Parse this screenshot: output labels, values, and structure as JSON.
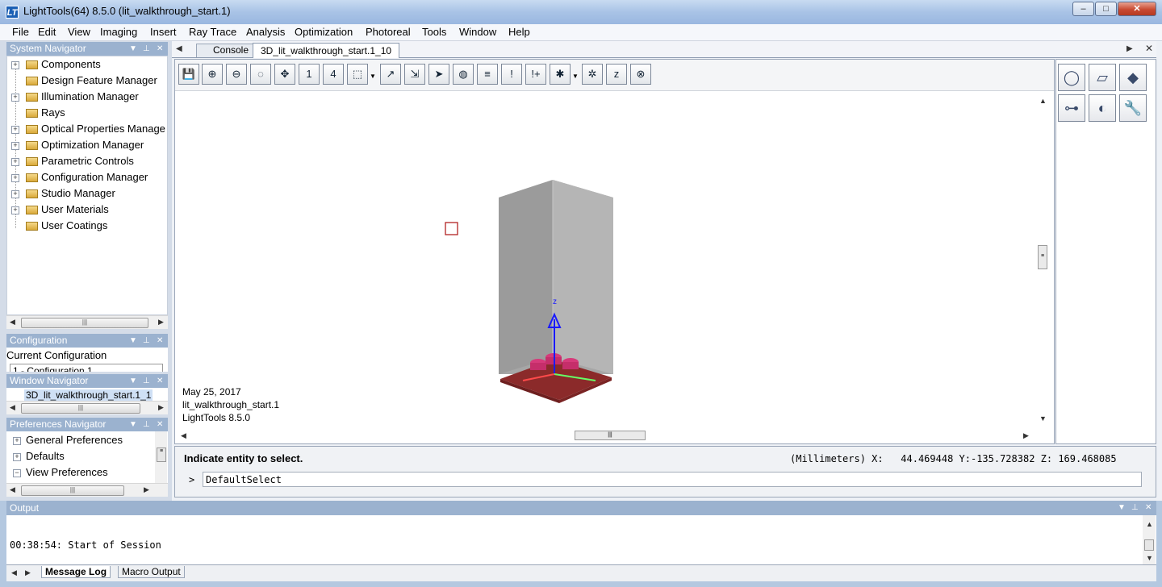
{
  "window": {
    "title": "LightTools(64) 8.5.0  (lit_walkthrough_start.1)",
    "app_icon": "LT",
    "minimize": "–",
    "maximize": "□",
    "close": "✕"
  },
  "menu": [
    "File",
    "Edit",
    "View",
    "Imaging",
    "Insert",
    "Ray Trace",
    "Analysis",
    "Optimization",
    "Photoreal",
    "Tools",
    "Window",
    "Help"
  ],
  "system_navigator": {
    "title": "System Navigator",
    "items": [
      "Components",
      "Design Feature Manager",
      "Illumination Manager",
      "Rays",
      "Optical Properties Manage",
      "Optimization Manager",
      "Parametric Controls",
      "Configuration Manager",
      "Studio Manager",
      "User Materials",
      "User Coatings"
    ]
  },
  "configuration_panel": {
    "title": "Configuration",
    "label": "Current Configuration",
    "value": "1 - Configuration 1"
  },
  "window_navigator": {
    "title": "Window Navigator",
    "item": "3D_lit_walkthrough_start.1_1"
  },
  "preferences_navigator": {
    "title": "Preferences Navigator",
    "items": [
      "General Preferences",
      "Defaults",
      "View Preferences"
    ]
  },
  "tabs": [
    "Console",
    "3D_lit_walkthrough_start.1_10"
  ],
  "toolbar_icons": [
    "save-icon",
    "zoom-in-icon",
    "zoom-out-icon",
    "zoom-window-icon",
    "zoom-all-icon",
    "view-1-icon",
    "view-4-icon",
    "wireframe-icon",
    "axes-icon",
    "ray-icon",
    "select-arrow-icon",
    "lens-icon",
    "text-icon",
    "warning-icon",
    "add-warning-icon",
    "filter-icon",
    "dim-icon",
    "z-icon",
    "rotate-icon"
  ],
  "toolbar_labels": {
    "view1": "1",
    "view4": "4",
    "z": "z"
  },
  "right_tools": [
    "lens-component-icon",
    "receiver-icon",
    "solid-primitives-icon",
    "binoculars-icon",
    "illumination-source-icon",
    "wrench-icon"
  ],
  "viewport": {
    "stamp_date": "May 25, 2017",
    "stamp_file": "lit_walkthrough_start.1",
    "stamp_version": "LightTools 8.5.0",
    "axis_z": "z"
  },
  "command": {
    "status": "Indicate entity to select.",
    "coords": "(Millimeters) X:   44.469448 Y:-135.728382 Z: 169.468085",
    "prompt": ">",
    "input_value": "DefaultSelect"
  },
  "output": {
    "title": "Output",
    "log_line": "00:38:54: Start of Session",
    "tabs": [
      "Message Log",
      "Macro Output"
    ]
  },
  "colors": {
    "panel_head": "#9bb2cf",
    "title_bar": "#a9c3e6",
    "housing": "#a6a6a6",
    "base": "#8b2a2a",
    "led": "#d63a7a",
    "axis_blue": "#1a1aff"
  }
}
